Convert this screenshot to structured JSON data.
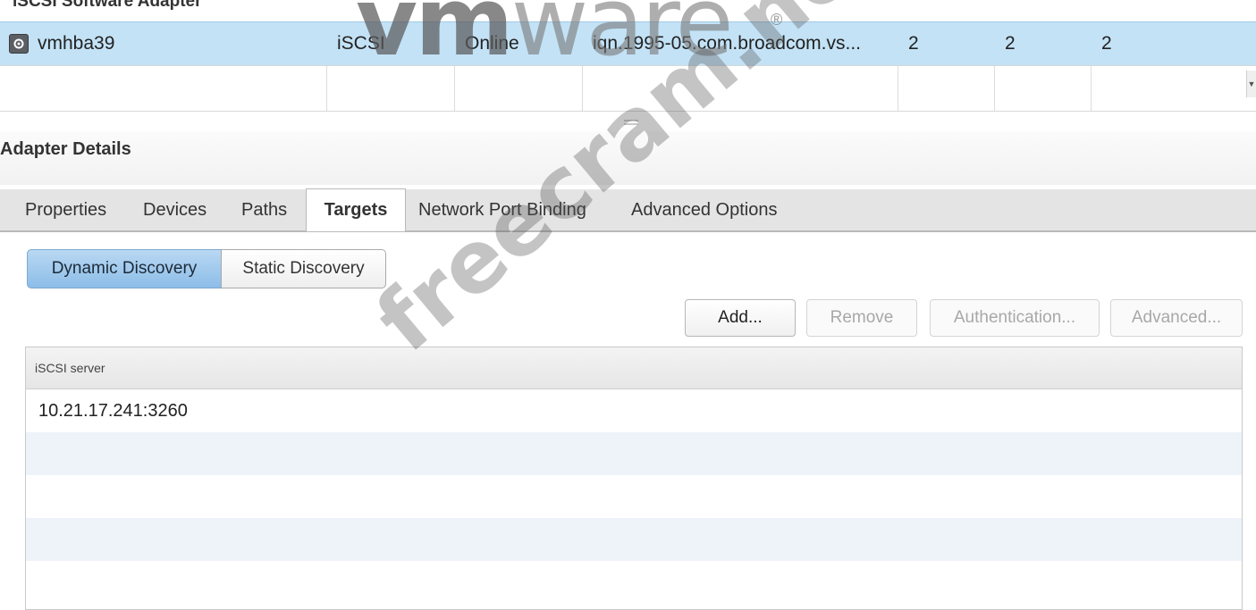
{
  "group_title": "iSCSI Software Adapter",
  "adapter_row": {
    "name": "vmhba39",
    "type": "iSCSI",
    "status": "Online",
    "identifier": "iqn.1995-05.com.broadcom.vs...",
    "targets": "2",
    "devices": "2",
    "paths": "2"
  },
  "details": {
    "title": "Adapter Details",
    "tabs": [
      "Properties",
      "Devices",
      "Paths",
      "Targets",
      "Network Port Binding",
      "Advanced Options"
    ],
    "active_tab": "Targets"
  },
  "discovery": {
    "dynamic_label": "Dynamic Discovery",
    "static_label": "Static Discovery",
    "selected": "Dynamic Discovery"
  },
  "actions": {
    "add": "Add...",
    "remove": "Remove",
    "authentication": "Authentication...",
    "advanced": "Advanced..."
  },
  "server_grid": {
    "column_header": "iSCSI server",
    "rows": [
      "10.21.17.241:3260"
    ]
  },
  "watermark": {
    "brand": "vmware",
    "site": "freecram.net"
  },
  "colors": {
    "selected_row": "#c3e2f6",
    "toggle_on": "#8cbde8",
    "tab_bar": "#e4e4e4"
  }
}
